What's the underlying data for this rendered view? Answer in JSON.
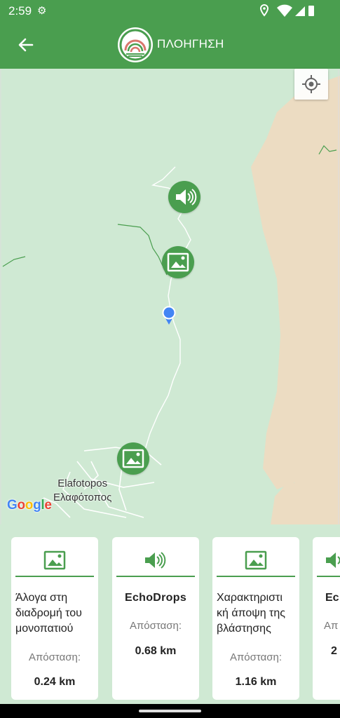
{
  "status_bar": {
    "time": "2:59"
  },
  "app_bar": {
    "title": "ΠΛΟΗΓΗΣΗ"
  },
  "map": {
    "town_latin": "Elafotopos",
    "town_greek": "Ελαφότοπος",
    "attribution": "Google"
  },
  "cards": [
    {
      "icon": "image-icon",
      "title": "Άλογα στη διαδρομή του μονοπατιού",
      "distance_label": "Απόσταση:",
      "distance": "0.24 km"
    },
    {
      "icon": "audio-icon",
      "title": "EchoDrops",
      "distance_label": "Απόσταση:",
      "distance": "0.68 km"
    },
    {
      "icon": "image-icon",
      "title": "Χαρακτηριστι κή άποψη της βλάστησης",
      "distance_label": "Απόσταση:",
      "distance": "1.16 km"
    },
    {
      "icon": "audio-icon",
      "title": "Ec",
      "distance_label": "Απ",
      "distance": "2"
    }
  ],
  "colors": {
    "primary": "#4a9e4f",
    "map_green": "#cfe9d3",
    "terrain": "#ecdcc2"
  }
}
